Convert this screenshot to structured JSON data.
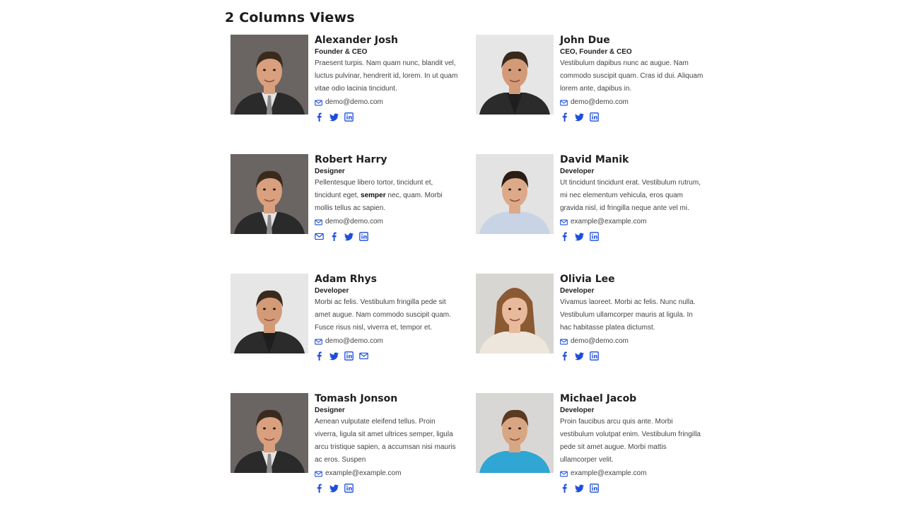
{
  "page": {
    "section_title": "2 Columns Views"
  },
  "accent_color": "#1d4ed8",
  "members": [
    {
      "name": "Alexander Josh",
      "role": "Founder & CEO",
      "bio_parts": [
        "Praesent turpis. Nam quam nunc, blandit vel, luctus pulvinar, hendrerit id, lorem. In ut quam vitae odio lacinia tincidunt."
      ],
      "email": "demo@demo.com",
      "socials": [
        "facebook-icon",
        "twitter-icon",
        "linkedin-icon"
      ]
    },
    {
      "name": "John Due",
      "role": "CEO, Founder & CEO",
      "bio_parts": [
        "Vestibulum dapibus nunc ac augue. Nam commodo suscipit quam. Cras id dui. Aliquam lorem ante, dapibus in."
      ],
      "email": "demo@demo.com",
      "socials": [
        "facebook-icon",
        "twitter-icon",
        "linkedin-icon"
      ]
    },
    {
      "name": "Robert Harry",
      "role": "Designer",
      "bio_parts": [
        "Pellentesque libero tortor, tincidunt et, tincidunt eget, ",
        "semper",
        " nec, quam. Morbi mollis tellus ac sapien."
      ],
      "email": "demo@demo.com",
      "socials": [
        "mail-icon",
        "facebook-icon",
        "twitter-icon",
        "linkedin-icon"
      ]
    },
    {
      "name": "David Manik",
      "role": "Developer",
      "bio_parts": [
        "Ut tincidunt tincidunt erat. Vestibulum rutrum, mi nec elementum vehicula, eros quam gravida nisl, id fringilla neque ante vel mi."
      ],
      "email": "example@example.com",
      "socials": [
        "facebook-icon",
        "twitter-icon",
        "linkedin-icon"
      ]
    },
    {
      "name": "Adam Rhys",
      "role": "Developer",
      "bio_parts": [
        "Morbi ac felis. Vestibulum fringilla pede sit amet augue. Nam commodo suscipit quam. Fusce risus nisl, viverra et, tempor et."
      ],
      "email": "demo@demo.com",
      "socials": [
        "facebook-icon",
        "twitter-icon",
        "linkedin-icon",
        "mail-icon"
      ]
    },
    {
      "name": "Olivia Lee",
      "role": "Developer",
      "bio_parts": [
        "Vivamus laoreet. Morbi ac felis. Nunc nulla. Vestibulum ullamcorper mauris at ligula. In hac habitasse platea dictumst."
      ],
      "email": "demo@demo.com",
      "socials": [
        "facebook-icon",
        "twitter-icon",
        "linkedin-icon"
      ]
    },
    {
      "name": "Tomash Jonson",
      "role": "Designer",
      "bio_parts": [
        "Aenean vulputate eleifend tellus. Proin viverra, ligula sit amet ultrices semper, ligula arcu tristique sapien, a accumsan nisi mauris ac eros. Suspen"
      ],
      "email": "example@example.com",
      "socials": [
        "facebook-icon",
        "twitter-icon",
        "linkedin-icon"
      ]
    },
    {
      "name": "Michael Jacob",
      "role": "Developer",
      "bio_parts": [
        "Proin faucibus arcu quis ante. Morbi vestibulum volutpat enim. Vestibulum fringilla pede sit amet augue. Morbi mattis ullamcorper velit."
      ],
      "email": "example@example.com",
      "socials": [
        "facebook-icon",
        "twitter-icon",
        "linkedin-icon"
      ]
    }
  ]
}
